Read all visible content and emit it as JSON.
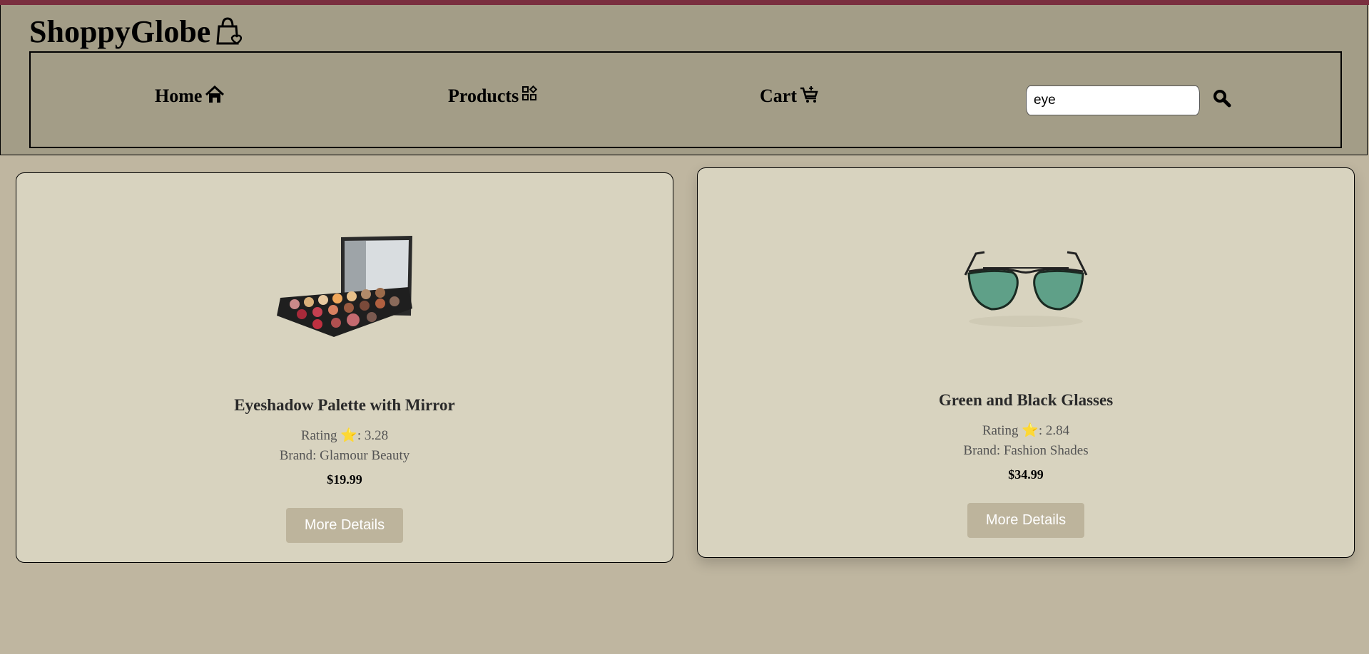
{
  "header": {
    "logo_text": "ShoppyGlobe",
    "nav": [
      {
        "label": "Home",
        "icon": "home-icon"
      },
      {
        "label": "Products",
        "icon": "grid-icon"
      },
      {
        "label": "Cart",
        "icon": "cart-icon"
      }
    ],
    "search": {
      "value": "eye",
      "icon": "search-icon"
    }
  },
  "products": [
    {
      "title": "Eyeshadow Palette with Mirror",
      "rating_label": "Rating",
      "rating_star": "⭐",
      "rating_value": ": 3.28",
      "brand": "Brand: Glamour Beauty",
      "price": "$19.99",
      "button": "More Details",
      "image": "eyeshadow-palette-image"
    },
    {
      "title": "Green and Black Glasses",
      "rating_label": "Rating",
      "rating_star": "⭐",
      "rating_value": ": 2.84",
      "brand": "Brand: Fashion Shades",
      "price": "$34.99",
      "button": "More Details",
      "image": "sunglasses-image"
    }
  ],
  "colors": {
    "page_bg": "#bfb6a0",
    "header_bg": "#a39d87",
    "card_bg": "#d8d3bf",
    "button_bg": "#bdb49c",
    "accent_top": "#7a2f3f"
  }
}
